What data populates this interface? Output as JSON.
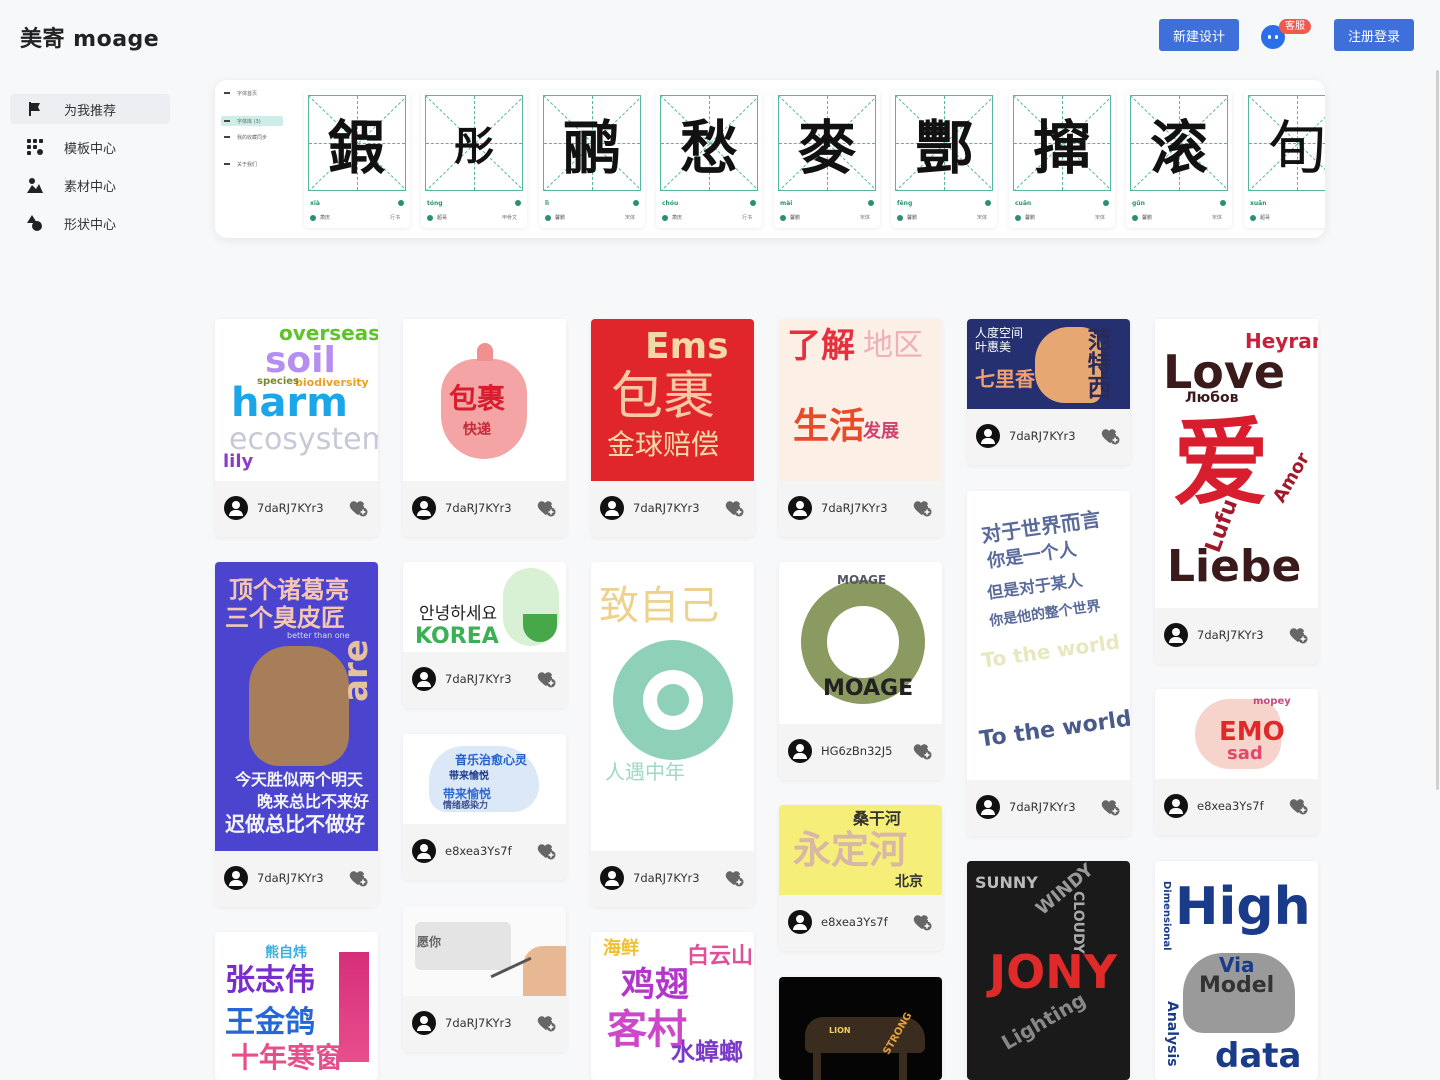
{
  "header": {
    "logo": "美寄 moage",
    "new_design": "新建设计",
    "cs_badge": "客服",
    "login": "注册登录"
  },
  "sidebar": {
    "items": [
      {
        "label": "为我推荐",
        "icon": "flag-icon"
      },
      {
        "label": "模板中心",
        "icon": "grid-icon"
      },
      {
        "label": "素材中心",
        "icon": "image-icon"
      },
      {
        "label": "形状中心",
        "icon": "shapes-icon"
      }
    ]
  },
  "fonts": {
    "menu": [
      "字体首页",
      "字体库 (3)",
      "我的收藏同步",
      "关于我们"
    ],
    "cards": [
      {
        "glyph": "鍜",
        "pinyin": "xià",
        "author": "萧庆",
        "style": "行书"
      },
      {
        "glyph": "彤",
        "pinyin": "tóng",
        "author": "超哥",
        "style": "甲骨文"
      },
      {
        "glyph": "鹂",
        "pinyin": "lì",
        "author": "馨鹏",
        "style": "宋体"
      },
      {
        "glyph": "愁",
        "pinyin": "chóu",
        "author": "萧庆",
        "style": "行书"
      },
      {
        "glyph": "麥",
        "pinyin": "mài",
        "author": "馨鹏",
        "style": "宋体"
      },
      {
        "glyph": "酆",
        "pinyin": "fēng",
        "author": "馨鹏",
        "style": "宋体"
      },
      {
        "glyph": "撺",
        "pinyin": "cuān",
        "author": "馨鹏",
        "style": "宋体"
      },
      {
        "glyph": "滚",
        "pinyin": "gǔn",
        "author": "馨鹏",
        "style": "宋体"
      },
      {
        "glyph": "旬",
        "pinyin": "xuān",
        "author": "超哥",
        "style": "甲骨"
      }
    ]
  },
  "gallery": {
    "cards": [
      {
        "user": "7daRJ7KYr3",
        "art": {
          "words": [
            "overseas",
            "soil",
            "harm",
            "ecosystem",
            "lily",
            "biodiversity",
            "species"
          ]
        }
      },
      {
        "user": "7daRJ7KYr3",
        "art": {
          "words": [
            "包裹",
            "快递"
          ]
        }
      },
      {
        "user": "7daRJ7KYr3",
        "art": {
          "words": [
            "Ems",
            "包裹",
            "金球赔偿"
          ]
        }
      },
      {
        "user": "7daRJ7KYr3",
        "art": {
          "words": [
            "了解",
            "地区",
            "生活",
            "发展"
          ]
        }
      },
      {
        "user": "7daRJ7KYr3",
        "art": {
          "words": [
            "人度空间",
            "叶惠美",
            "范特西",
            "七里香"
          ]
        }
      },
      {
        "user": "7daRJ7KYr3",
        "art": {
          "words": [
            "Heyran",
            "Love",
            "Любов",
            "爱",
            "Liebe",
            "Amor",
            "Lufu"
          ]
        }
      },
      {
        "user": "7daRJ7KYr3",
        "art": {
          "words": [
            "顶个诸葛亮",
            "三个臭皮匠",
            "are",
            "better than one",
            "今天胜似两个明天",
            "晚来总比不来好",
            "迟做总比不做好"
          ]
        }
      },
      {
        "user": "7daRJ7KYr3",
        "art": {
          "words": [
            "안녕하세요",
            "KOREA"
          ]
        }
      },
      {
        "user": "7daRJ7KYr3",
        "art": {
          "words": [
            "致自己",
            "人遇中年"
          ]
        }
      },
      {
        "user": "HG6zBn32J5",
        "art": {
          "words": [
            "MOAGE"
          ]
        }
      },
      {
        "user": "7daRJ7KYr3",
        "art": {
          "words": [
            "对于世界而言",
            "你是一个人",
            "但是对于某人",
            "你是他的整个世界",
            "To the world"
          ]
        }
      },
      {
        "user": "e8xea3Ys7f",
        "art": {
          "words": [
            "EMO",
            "sad",
            "mopey"
          ]
        }
      },
      {
        "user": "e8xea3Ys7f",
        "art": {
          "words": [
            "音乐治愈心灵",
            "带来愉悦",
            "情绪感染力"
          ]
        }
      },
      {
        "user": "e8xea3Ys7f",
        "art": {
          "words": [
            "永定河",
            "桑干河",
            "北京"
          ]
        }
      },
      {
        "user": "7daRJ7KYr3",
        "art": {
          "words": [
            "愿你"
          ]
        }
      },
      {
        "user": "",
        "art": {
          "words": [
            "张志伟",
            "王金鸽",
            "十年寒窗",
            "熊自炜"
          ]
        }
      },
      {
        "user": "",
        "art": {
          "words": [
            "海鲜",
            "鸡翅",
            "客村",
            "水蟑螂",
            "白云山"
          ]
        }
      },
      {
        "user": "",
        "art": {
          "words": [
            "STRONG",
            "LION"
          ]
        }
      },
      {
        "user": "",
        "art": {
          "words": [
            "SUNNY",
            "WINDY",
            "CLOUDY",
            "JONY",
            "Lighting"
          ]
        }
      },
      {
        "user": "",
        "art": {
          "words": [
            "High",
            "Via",
            "Model",
            "Dimensional",
            "Analysis",
            "data"
          ]
        }
      }
    ]
  }
}
